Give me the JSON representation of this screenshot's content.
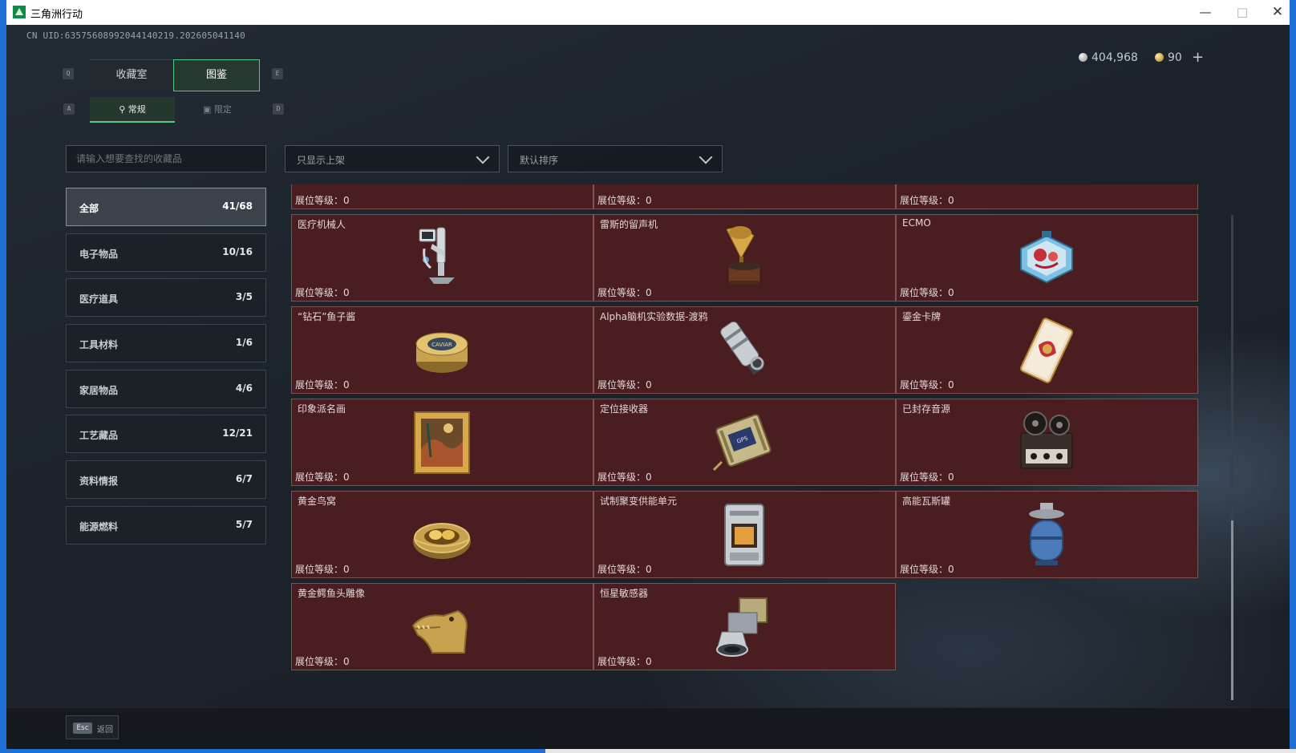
{
  "window": {
    "title": "三角洲行动"
  },
  "uid": "CN UID:635756089920441402​19.202605041140",
  "currency": {
    "silver": "404,968",
    "gold": "90",
    "plus": "+"
  },
  "keys": {
    "q": "Q",
    "e": "E",
    "a": "A",
    "d": "D"
  },
  "tabs": {
    "collection": "收藏室",
    "catalog": "图鉴"
  },
  "subtabs": {
    "normal": "常规",
    "limited": "限定"
  },
  "search": {
    "placeholder": "请输入想要查找的收藏品"
  },
  "filters": {
    "shelf": "只显示上架",
    "sort": "默认排序"
  },
  "categories": [
    {
      "name": "全部",
      "count": "41/68"
    },
    {
      "name": "电子物品",
      "count": "10/16"
    },
    {
      "name": "医疗道具",
      "count": "3/5"
    },
    {
      "name": "工具材料",
      "count": "1/6"
    },
    {
      "name": "家居物品",
      "count": "4/6"
    },
    {
      "name": "工艺藏品",
      "count": "12/21"
    },
    {
      "name": "资料情报",
      "count": "6/7"
    },
    {
      "name": "能源燃料",
      "count": "5/7"
    }
  ],
  "level_label": "展位等级：0",
  "items": [
    {
      "name": "",
      "icon": "partial-item-icon"
    },
    {
      "name": "",
      "icon": "partial-item-icon"
    },
    {
      "name": "",
      "icon": "partial-item-icon"
    },
    {
      "name": "医疗机械人",
      "icon": "medical-robot-icon"
    },
    {
      "name": "雷斯的留声机",
      "icon": "gramophone-icon"
    },
    {
      "name": "ECMO",
      "icon": "ecmo-icon"
    },
    {
      "name": "“钻石”鱼子酱",
      "icon": "caviar-icon"
    },
    {
      "name": "Alpha脑机实验数据-渡鸦",
      "icon": "data-drive-icon"
    },
    {
      "name": "鎏金卡牌",
      "icon": "gold-card-icon"
    },
    {
      "name": "印象派名画",
      "icon": "painting-icon"
    },
    {
      "name": "定位接收器",
      "icon": "gps-receiver-icon"
    },
    {
      "name": "已封存音源",
      "icon": "tape-recorder-icon"
    },
    {
      "name": "黄金鸟窝",
      "icon": "golden-nest-icon"
    },
    {
      "name": "试制聚变供能单元",
      "icon": "fusion-unit-icon"
    },
    {
      "name": "高能瓦斯罐",
      "icon": "gas-tank-icon"
    },
    {
      "name": "黄金鳄鱼头雕像",
      "icon": "croc-statue-icon"
    },
    {
      "name": "恒星敏感器",
      "icon": "star-sensor-icon"
    }
  ],
  "bottom": {
    "esc_key": "Esc",
    "back": "返回"
  },
  "colors": {
    "accent": "#4fc88a",
    "card_bg": "#4a1e21",
    "card_border": "#82504f"
  }
}
